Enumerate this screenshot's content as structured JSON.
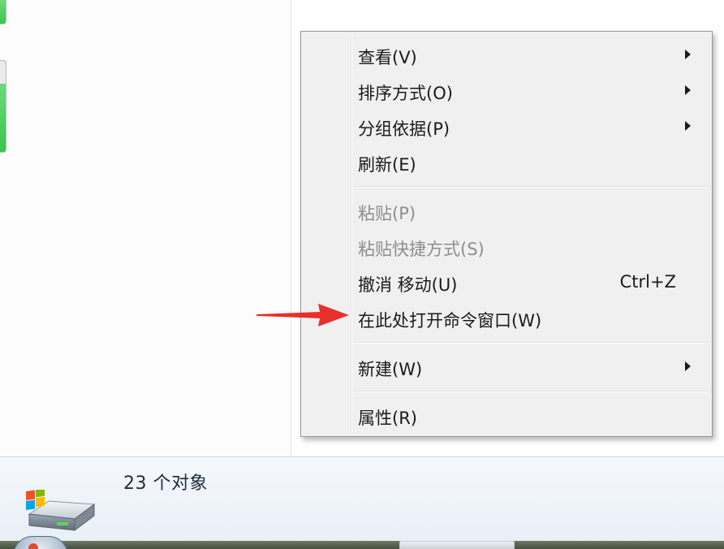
{
  "menu": {
    "items": [
      {
        "label": "查看(V)",
        "submenu": true
      },
      {
        "label": "排序方式(O)",
        "submenu": true
      },
      {
        "label": "分组依据(P)",
        "submenu": true
      },
      {
        "label": "刷新(E)"
      },
      {
        "label": "粘贴(P)",
        "disabled": true
      },
      {
        "label": "粘贴快捷方式(S)",
        "disabled": true
      },
      {
        "label": "撤消 移动(U)",
        "shortcut": "Ctrl+Z"
      },
      {
        "label": "在此处打开命令窗口(W)"
      },
      {
        "label": "新建(W)",
        "submenu": true
      },
      {
        "label": "属性(R)"
      }
    ]
  },
  "status": {
    "item_count": "23 个对象"
  },
  "annotation": {
    "arrow_color": "#e8302a"
  },
  "icons": {
    "submenu": "chevron-right-icon",
    "drive": "hard-drive-icon",
    "start": "windows-start-icon"
  }
}
